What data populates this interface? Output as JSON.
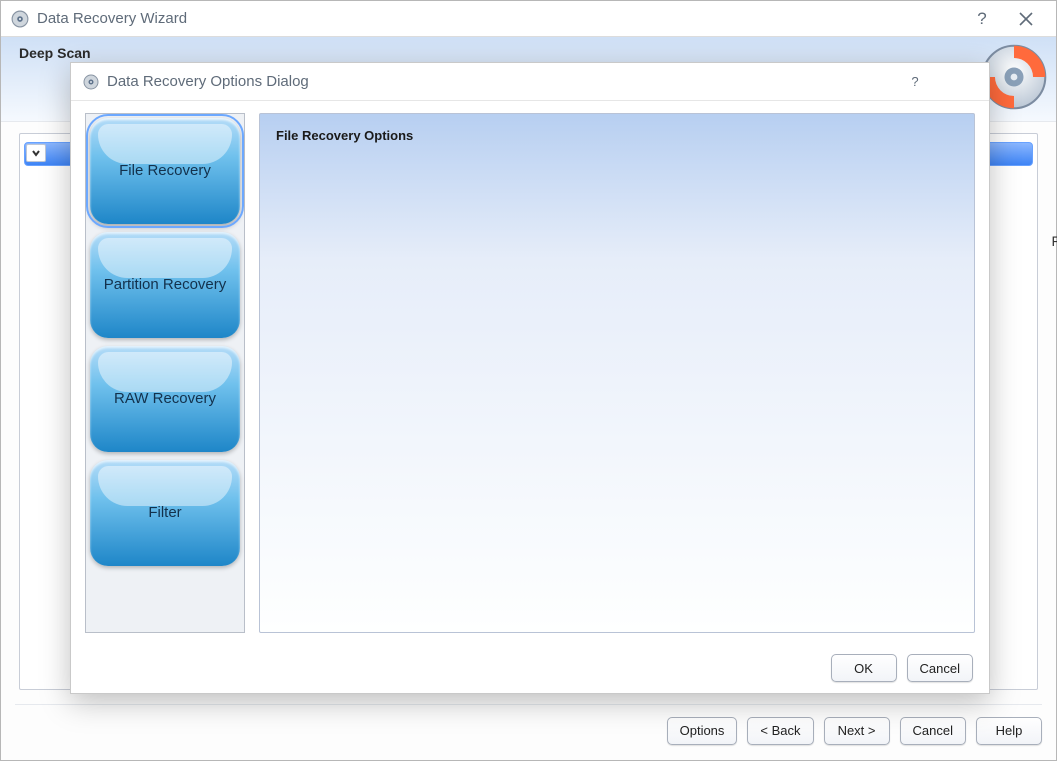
{
  "wizard": {
    "title": "Data Recovery Wizard",
    "header_title": "Deep Scan",
    "footer": {
      "options": "Options",
      "back": "< Back",
      "next": "Next >",
      "cancel": "Cancel",
      "help": "Help"
    }
  },
  "dialog": {
    "title": "Data Recovery Options Dialog",
    "sidebar": {
      "file_recovery": "File Recovery",
      "partition_recovery": "Partition Recovery",
      "raw_recovery": "RAW Recovery",
      "filter": "Filter"
    },
    "content_heading": "File Recovery Options",
    "footer": {
      "ok": "OK",
      "cancel": "Cancel"
    }
  },
  "edge_label": "F"
}
